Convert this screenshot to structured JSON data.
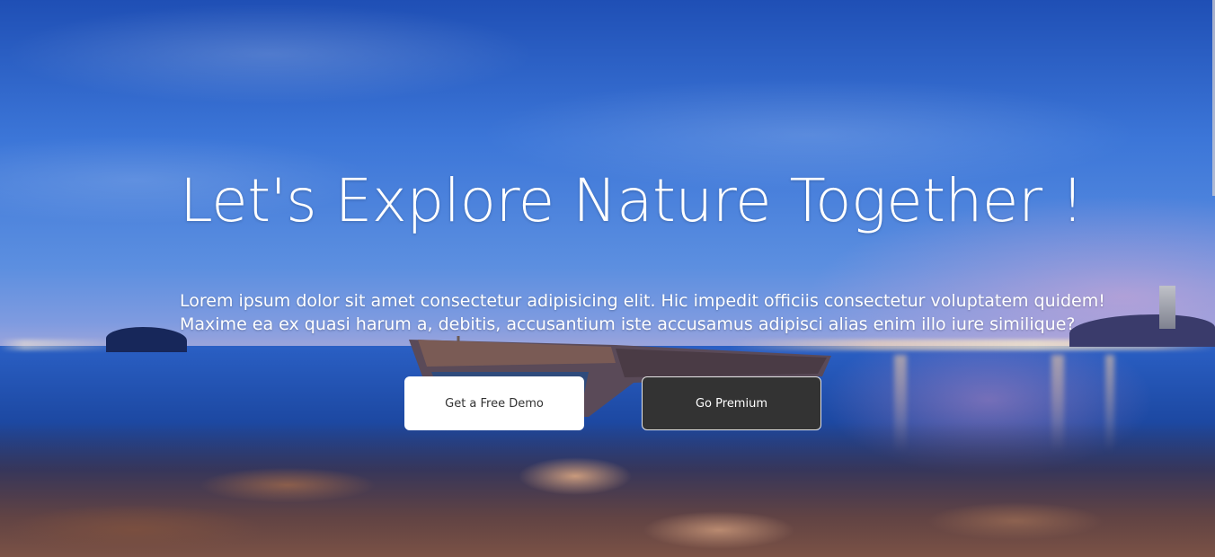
{
  "hero": {
    "title": "Let's Explore Nature Together !",
    "description": "Lorem ipsum dolor sit amet consectetur adipisicing elit. Hic impedit officiis consectetur voluptatem quidem! Maxime ea ex quasi harum a, debitis, accusantium iste accusamus adipisci alias enim illo iure similique?",
    "background_image": "night seascape with shipwreck, rocky shore and city lights",
    "buttons": {
      "demo_label": "Get a Free Demo",
      "premium_label": "Go Premium"
    }
  },
  "colors": {
    "text": "#ffffff",
    "demo_button_bg": "#ffffff",
    "demo_button_text": "#333333",
    "premium_button_bg": "#333333",
    "premium_button_text": "#ffffff"
  }
}
